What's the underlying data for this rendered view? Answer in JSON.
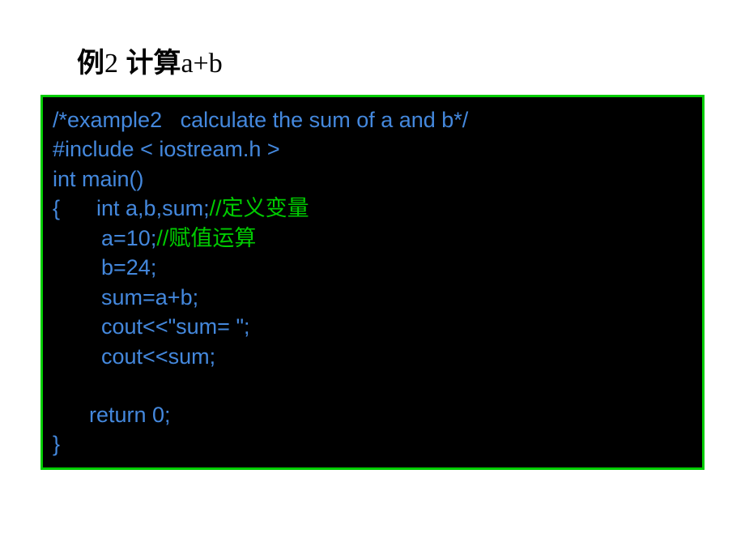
{
  "title": {
    "prefix": "例",
    "num": "2",
    "text": " 计算",
    "expr": "a+b"
  },
  "code": {
    "l1": "/*example2   calculate the sum of a and b*/",
    "l2": "#include < iostream.h >",
    "l3": "int main()",
    "l4a": "{      int a,b,sum;",
    "l4b": "//定义变量",
    "l5a": "        a=10;",
    "l5b": "//赋值运算",
    "l6": "        b=24;",
    "l7": "        sum=a+b;",
    "l8": "        cout<<\"sum= \";",
    "l9": "        cout<<sum;",
    "l10": "      return 0;",
    "l11": "}"
  }
}
